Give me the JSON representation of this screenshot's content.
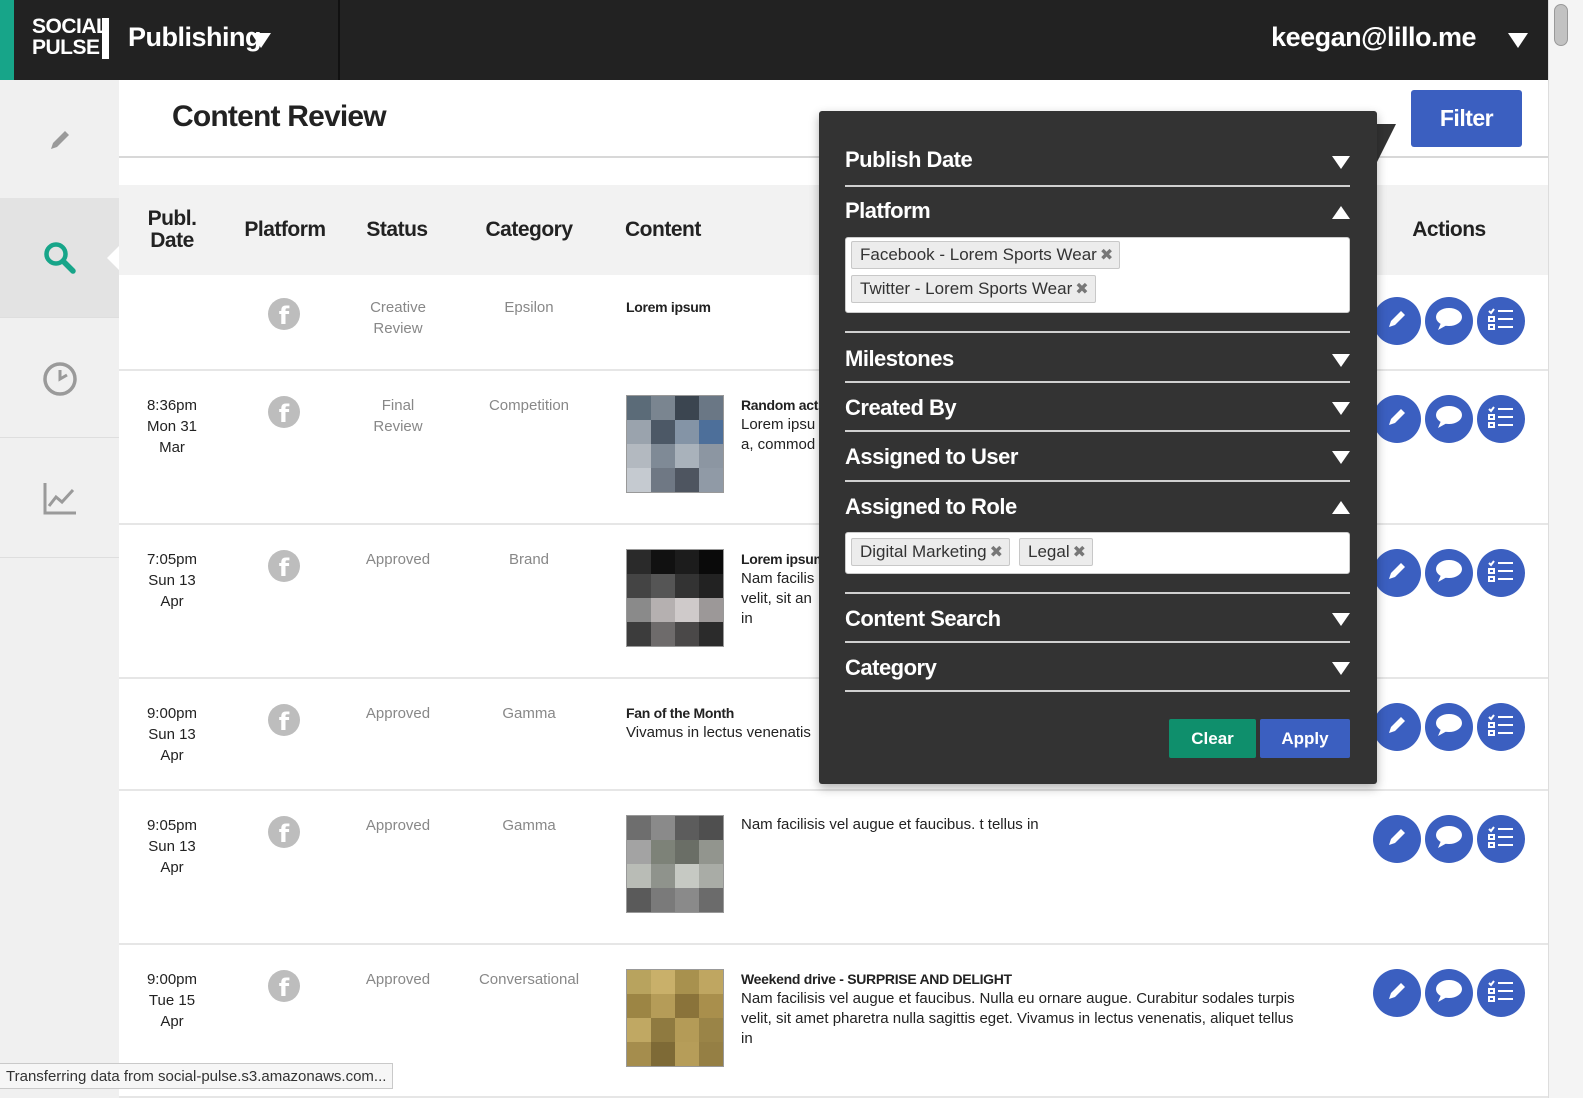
{
  "topbar": {
    "logo_line1": "SOCIAL",
    "logo_line2": "PULSE",
    "app_name": "Publishing",
    "user": "keegan@lillo.me"
  },
  "sidebar": {
    "items": [
      {
        "icon": "pencil-icon"
      },
      {
        "icon": "search-icon",
        "active": true
      },
      {
        "icon": "clock-icon"
      },
      {
        "icon": "chart-icon"
      }
    ]
  },
  "page": {
    "title": "Content Review",
    "filter_label": "Filter"
  },
  "table": {
    "headers": {
      "date_line1": "Publ.",
      "date_line2": "Date",
      "platform": "Platform",
      "status": "Status",
      "category": "Category",
      "content": "Content",
      "actions": "Actions"
    },
    "rows": [
      {
        "time": "",
        "day": "",
        "date": "",
        "status1": "Creative",
        "status2": "Review",
        "category": "Epsilon",
        "title": "Lorem ipsum",
        "body1": "",
        "body2": "",
        "body3": ""
      },
      {
        "time": "8:36pm",
        "day": "Mon 31",
        "date": "Mar",
        "status1": "Final",
        "status2": "Review",
        "category": "Competition",
        "title": "Random acts",
        "body1": "Lorem ipsu",
        "body2": "a, commod",
        "body3": ""
      },
      {
        "time": "7:05pm",
        "day": "Sun 13",
        "date": "Apr",
        "status1": "Approved",
        "status2": "",
        "category": "Brand",
        "title": "Lorem ipsum",
        "body1": "Nam facilis",
        "body2": "velit, sit an",
        "body3": "in"
      },
      {
        "time": "9:00pm",
        "day": "Sun 13",
        "date": "Apr",
        "status1": "Approved",
        "status2": "",
        "category": "Gamma",
        "title": "Fan of the Month",
        "body1": "Vivamus in lectus venenatis",
        "body2": "",
        "body3": ""
      },
      {
        "time": "9:05pm",
        "day": "Sun 13",
        "date": "Apr",
        "status1": "Approved",
        "status2": "",
        "category": "Gamma",
        "title": "",
        "body1": "Nam facilisis vel augue et faucibus. t tellus in",
        "body2": "",
        "body3": ""
      },
      {
        "time": "9:00pm",
        "day": "Tue 15",
        "date": "Apr",
        "status1": "Approved",
        "status2": "",
        "category": "Conversational",
        "title": "Weekend drive - SURPRISE AND DELIGHT",
        "body1": "Nam facilisis vel augue et faucibus. Nulla eu ornare augue. Curabitur sodales turpis",
        "body2": "velit, sit amet pharetra nulla sagittis eget. Vivamus in lectus venenatis, aliquet tellus",
        "body3": "in"
      }
    ]
  },
  "filter_panel": {
    "sections": {
      "publish_date": "Publish Date",
      "platform": "Platform",
      "milestones": "Milestones",
      "created_by": "Created By",
      "assigned_user": "Assigned to User",
      "assigned_role": "Assigned to Role",
      "content_search": "Content Search",
      "category": "Category"
    },
    "platform_tags": [
      "Facebook - Lorem Sports Wear",
      "Twitter - Lorem Sports Wear"
    ],
    "role_tags": [
      "Digital Marketing",
      "Legal"
    ],
    "clear_label": "Clear",
    "apply_label": "Apply"
  },
  "colors": {
    "accent_teal": "#17a589",
    "action_blue": "#3b5fc0",
    "panel_bg": "#333333",
    "topbar_bg": "#222222"
  },
  "status_bar": "Transferring data from social-pulse.s3.amazonaws.com..."
}
